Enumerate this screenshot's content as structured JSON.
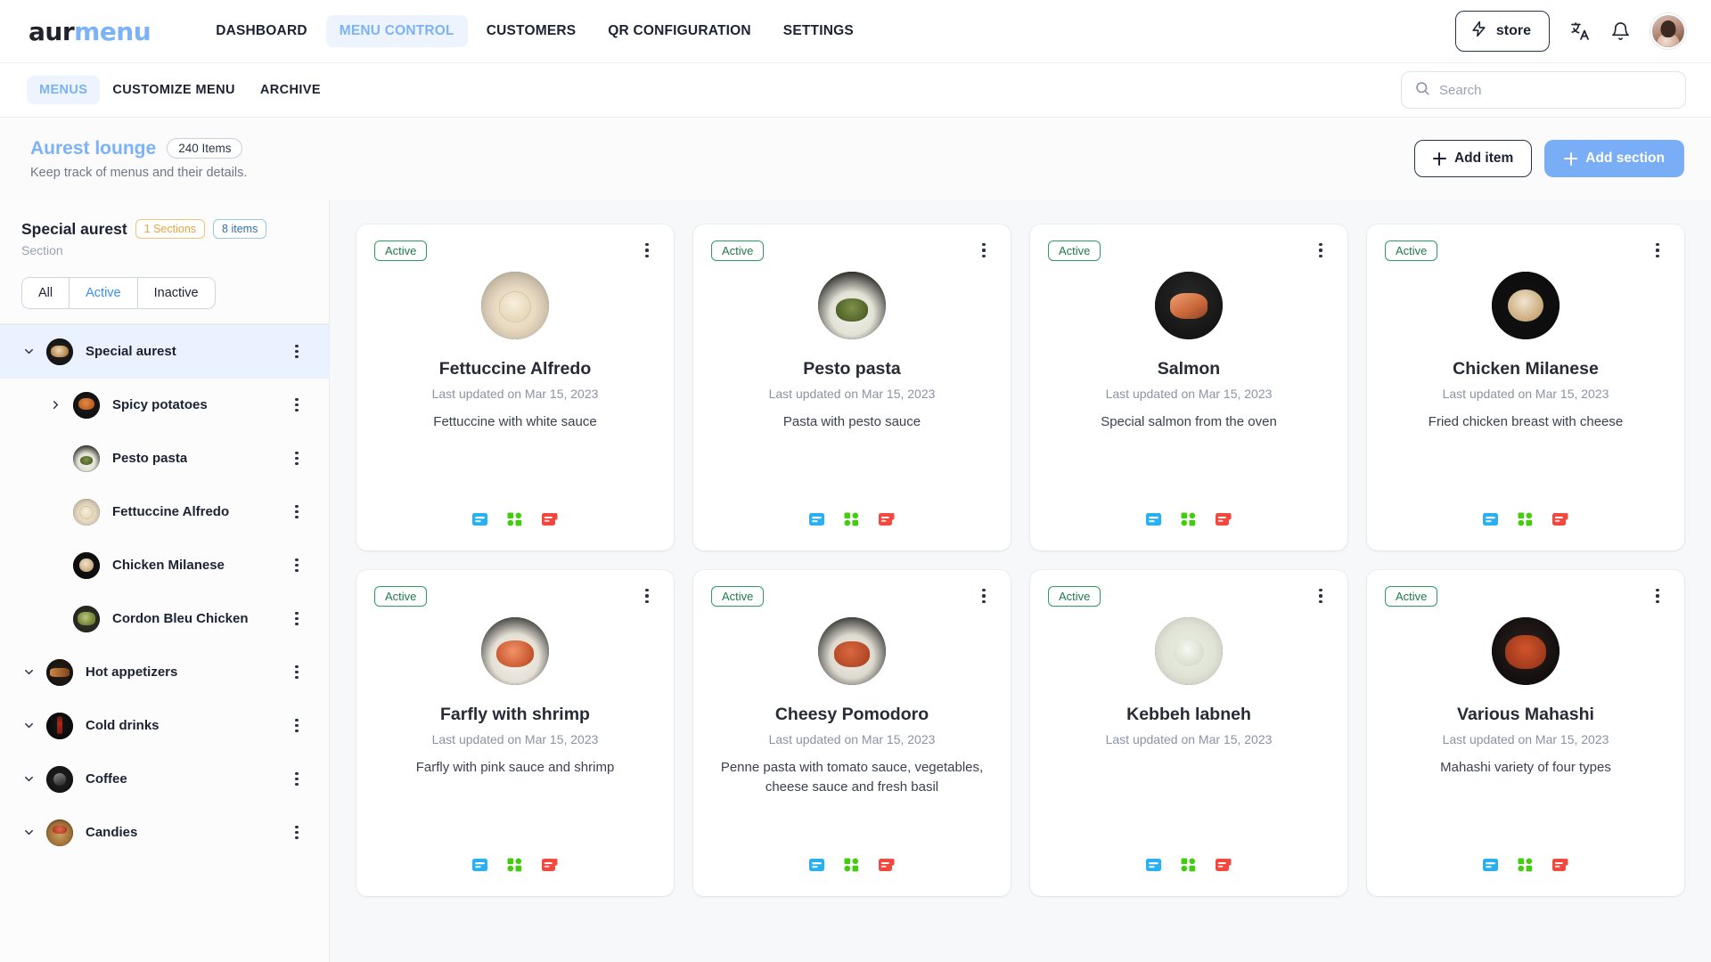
{
  "brand": {
    "part1": "aur",
    "part2": "menu"
  },
  "topnav": {
    "items": [
      {
        "label": "DASHBOARD",
        "active": false
      },
      {
        "label": "MENU CONTROL",
        "active": true
      },
      {
        "label": "CUSTOMERS",
        "active": false
      },
      {
        "label": "QR CONFIGURATION",
        "active": false
      },
      {
        "label": "SETTINGS",
        "active": false
      }
    ],
    "store_label": "store",
    "icons": {
      "bolt": "bolt-icon",
      "translate": "translate-icon",
      "bell": "notification-bell-icon",
      "avatar": "user-avatar"
    }
  },
  "subnav": {
    "items": [
      {
        "label": "MENUS",
        "active": true
      },
      {
        "label": "CUSTOMIZE MENU",
        "active": false
      },
      {
        "label": "ARCHIVE",
        "active": false
      }
    ],
    "search": {
      "placeholder": "Search",
      "value": ""
    }
  },
  "pagehead": {
    "title": "Aurest lounge",
    "items_badge": "240 Items",
    "subtitle": "Keep track of menus and their details.",
    "add_item_label": "Add item",
    "add_section_label": "Add section"
  },
  "sidebar": {
    "title": "Special aurest",
    "sections_chip": "1 Sections",
    "items_chip": "8 items",
    "subtitle": "Section",
    "filters": [
      {
        "label": "All",
        "active": false
      },
      {
        "label": "Active",
        "active": true
      },
      {
        "label": "Inactive",
        "active": false
      }
    ],
    "tree": [
      {
        "label": "Special aurest",
        "level": 0,
        "caret": "down",
        "selected": true,
        "thumb": "ph-special"
      },
      {
        "label": "Spicy potatoes",
        "level": 1,
        "caret": "right",
        "selected": false,
        "thumb": "ph-potatoes"
      },
      {
        "label": "Pesto pasta",
        "level": 1,
        "caret": "none",
        "selected": false,
        "thumb": "ph-pesto"
      },
      {
        "label": "Fettuccine Alfredo",
        "level": 1,
        "caret": "none",
        "selected": false,
        "thumb": "ph-alfredo"
      },
      {
        "label": "Chicken Milanese",
        "level": 1,
        "caret": "none",
        "selected": false,
        "thumb": "ph-milanese"
      },
      {
        "label": "Cordon Bleu Chicken",
        "level": 1,
        "caret": "none",
        "selected": false,
        "thumb": "ph-cordon"
      },
      {
        "label": "Hot appetizers",
        "level": 0,
        "caret": "down",
        "selected": false,
        "thumb": "ph-hotapp"
      },
      {
        "label": "Cold drinks",
        "level": 0,
        "caret": "down",
        "selected": false,
        "thumb": "ph-colddrinks"
      },
      {
        "label": "Coffee",
        "level": 0,
        "caret": "down",
        "selected": false,
        "thumb": "ph-coffee"
      },
      {
        "label": "Candies",
        "level": 0,
        "caret": "down",
        "selected": false,
        "thumb": "ph-candies"
      }
    ]
  },
  "cards": [
    {
      "status": "Active",
      "title": "Fettuccine Alfredo",
      "updated": "Last updated on Mar 15, 2023",
      "description": "Fettuccine with white sauce",
      "thumb": "ph-alfredo"
    },
    {
      "status": "Active",
      "title": "Pesto pasta",
      "updated": "Last updated on Mar 15, 2023",
      "description": "Pasta with pesto sauce",
      "thumb": "ph-pesto"
    },
    {
      "status": "Active",
      "title": "Salmon",
      "updated": "Last updated on Mar 15, 2023",
      "description": "Special salmon from the oven",
      "thumb": "ph-salmon"
    },
    {
      "status": "Active",
      "title": "Chicken Milanese",
      "updated": "Last updated on Mar 15, 2023",
      "description": "Fried chicken breast with cheese",
      "thumb": "ph-milanese"
    },
    {
      "status": "Active",
      "title": "Farfly with shrimp",
      "updated": "Last updated on Mar 15, 2023",
      "description": "Farfly with pink sauce and shrimp",
      "thumb": "ph-farfly"
    },
    {
      "status": "Active",
      "title": "Cheesy Pomodoro",
      "updated": "Last updated on Mar 15, 2023",
      "description": "Penne pasta with tomato sauce, vegetables, cheese sauce and fresh basil",
      "thumb": "ph-pomodoro"
    },
    {
      "status": "Active",
      "title": "Kebbeh labneh",
      "updated": "Last updated on Mar 15, 2023",
      "description": "",
      "thumb": "ph-kebbeh"
    },
    {
      "status": "Active",
      "title": "Various Mahashi",
      "updated": "Last updated on Mar 15, 2023",
      "description": "Mahashi variety of four types",
      "thumb": "ph-mahashi"
    }
  ],
  "card_action_icons": [
    {
      "name": "edit-card-icon",
      "color": "#29b0f3"
    },
    {
      "name": "grid-options-icon",
      "color": "#44cc11"
    },
    {
      "name": "delete-card-icon",
      "color": "#f4483e"
    }
  ],
  "colors": {
    "accent_blue": "#7cb2f7",
    "nav_active_bg": "#edf4fe",
    "active_badge_green": "#2f9b63",
    "chip_orange": "#e8a33d",
    "chip_blue": "#2f6fa8",
    "content_bg": "#f7f8fa"
  }
}
